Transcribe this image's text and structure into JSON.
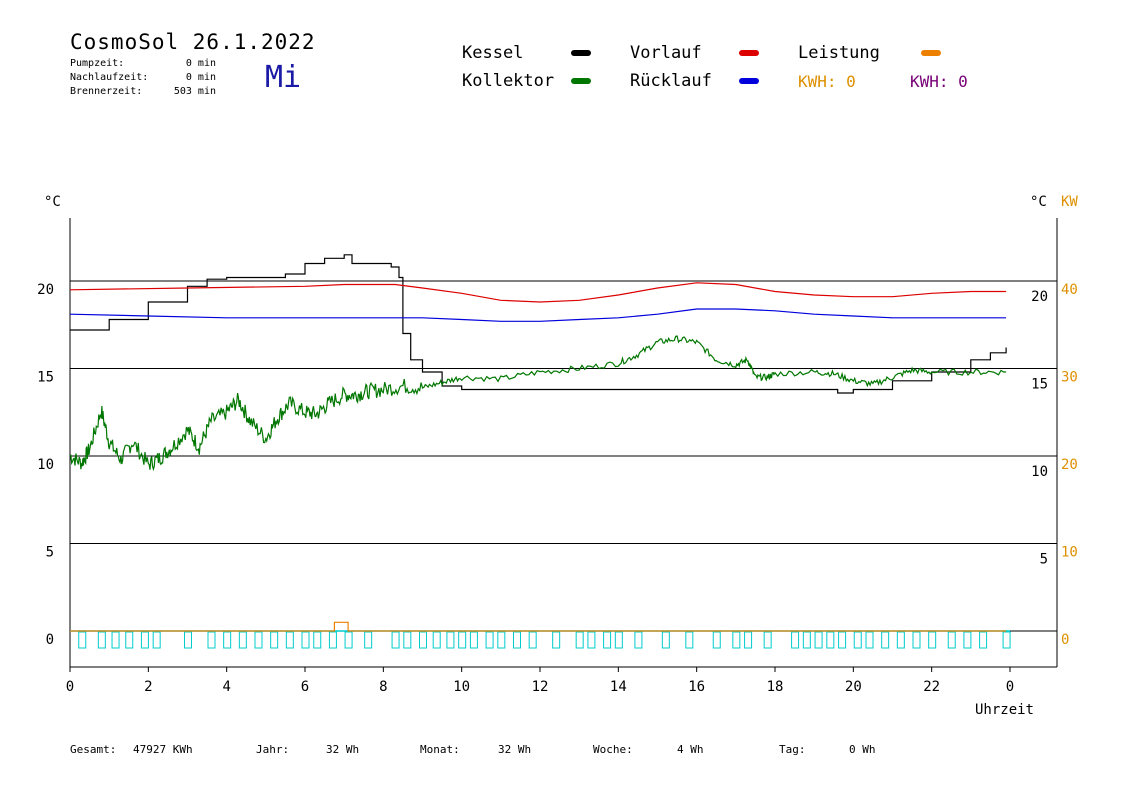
{
  "header": {
    "title": "CosmoSol 26.1.2022",
    "weekday": "Mi",
    "stats": [
      {
        "label": "Pumpzeit:",
        "value": "0 min"
      },
      {
        "label": "Nachlaufzeit:",
        "value": "0 min"
      },
      {
        "label": "Brennerzeit:",
        "value": "503 min"
      }
    ]
  },
  "legend": {
    "kessel": "Kessel",
    "kollektor": "Kollektor",
    "vorlauf": "Vorlauf",
    "ruecklauf": "Rücklauf",
    "leistung": "Leistung",
    "kwh_orange": "KWH: 0",
    "kwh_purple": "KWH: 0"
  },
  "colors": {
    "kessel": "#000000",
    "kollektor": "#007700",
    "vorlauf": "#dd0000",
    "ruecklauf": "#0000dd",
    "leistung": "#ee8000",
    "kw_axis": "#dd9000",
    "kwh_purple": "#770077",
    "pump": "#00cccc",
    "weekday": "#1a1aa6"
  },
  "footer": {
    "gesamt_label": "Gesamt:",
    "gesamt_value": "47927 KWh",
    "jahr_label": "Jahr:",
    "jahr_value": "32 Wh",
    "monat_label": "Monat:",
    "monat_value": "32 Wh",
    "woche_label": "Woche:",
    "woche_value": "4 Wh",
    "tag_label": "Tag:",
    "tag_value": "0 Wh"
  },
  "chart_data": {
    "type": "line",
    "x_label": "Uhrzeit",
    "x_ticks": [
      "0",
      "2",
      "4",
      "6",
      "8",
      "10",
      "12",
      "14",
      "16",
      "18",
      "20",
      "22",
      "0"
    ],
    "y_left_label": "°C",
    "y_left_ticks": [
      "0",
      "5",
      "10",
      "15",
      "20"
    ],
    "y_right_label": "°C",
    "y_right_ticks": [
      "5",
      "10",
      "15",
      "20"
    ],
    "y_kw_label": "KW",
    "y_kw_ticks": [
      "0",
      "10",
      "20",
      "30",
      "40"
    ],
    "xlim": [
      0,
      24
    ],
    "ylim": [
      -2,
      24
    ],
    "grid_lines_y": [
      0,
      5,
      10,
      15,
      20
    ],
    "series": [
      {
        "name": "Kessel",
        "color_key": "kessel",
        "step": true,
        "points": [
          [
            0,
            17.2
          ],
          [
            1,
            17.8
          ],
          [
            2,
            18.8
          ],
          [
            3,
            19.7
          ],
          [
            3.5,
            20.1
          ],
          [
            4,
            20.2
          ],
          [
            5,
            20.2
          ],
          [
            5.5,
            20.4
          ],
          [
            6,
            21
          ],
          [
            6.5,
            21.3
          ],
          [
            7,
            21.5
          ],
          [
            7.2,
            21
          ],
          [
            7.7,
            21
          ],
          [
            8.2,
            20.8
          ],
          [
            8.4,
            20.2
          ],
          [
            8.5,
            17
          ],
          [
            8.7,
            15.5
          ],
          [
            9,
            14.8
          ],
          [
            9.5,
            14
          ],
          [
            10,
            13.8
          ],
          [
            12,
            13.8
          ],
          [
            16,
            13.8
          ],
          [
            19.5,
            13.8
          ],
          [
            19.6,
            13.6
          ],
          [
            20,
            13.8
          ],
          [
            21,
            14.3
          ],
          [
            22,
            14.8
          ],
          [
            23,
            15.5
          ],
          [
            23.5,
            15.9
          ],
          [
            23.9,
            16.2
          ]
        ]
      },
      {
        "name": "Vorlauf",
        "color_key": "vorlauf",
        "points": [
          [
            0,
            19.5
          ],
          [
            3,
            19.6
          ],
          [
            6,
            19.7
          ],
          [
            7,
            19.8
          ],
          [
            8.3,
            19.8
          ],
          [
            9,
            19.6
          ],
          [
            10,
            19.3
          ],
          [
            11,
            18.9
          ],
          [
            12,
            18.8
          ],
          [
            13,
            18.9
          ],
          [
            14,
            19.2
          ],
          [
            15,
            19.6
          ],
          [
            16,
            19.9
          ],
          [
            17,
            19.8
          ],
          [
            18,
            19.4
          ],
          [
            19,
            19.2
          ],
          [
            20,
            19.1
          ],
          [
            21,
            19.1
          ],
          [
            22,
            19.3
          ],
          [
            23,
            19.4
          ],
          [
            23.9,
            19.4
          ]
        ]
      },
      {
        "name": "Rücklauf",
        "color_key": "ruecklauf",
        "points": [
          [
            0,
            18.1
          ],
          [
            2,
            18
          ],
          [
            4,
            17.9
          ],
          [
            6,
            17.9
          ],
          [
            8,
            17.9
          ],
          [
            9,
            17.9
          ],
          [
            10,
            17.8
          ],
          [
            11,
            17.7
          ],
          [
            12,
            17.7
          ],
          [
            13,
            17.8
          ],
          [
            14,
            17.9
          ],
          [
            15,
            18.1
          ],
          [
            16,
            18.4
          ],
          [
            17,
            18.4
          ],
          [
            18,
            18.3
          ],
          [
            19,
            18.1
          ],
          [
            20,
            18
          ],
          [
            21,
            17.9
          ],
          [
            22,
            17.9
          ],
          [
            23,
            17.9
          ],
          [
            23.9,
            17.9
          ]
        ]
      },
      {
        "name": "Kollektor",
        "color_key": "kollektor",
        "noisy": true,
        "points": [
          [
            0,
            10
          ],
          [
            0.3,
            9.6
          ],
          [
            0.5,
            10.4
          ],
          [
            0.8,
            12.6
          ],
          [
            1,
            10.8
          ],
          [
            1.3,
            9.8
          ],
          [
            1.6,
            10.8
          ],
          [
            2,
            9.5
          ],
          [
            2.3,
            9.9
          ],
          [
            2.6,
            10.5
          ],
          [
            3,
            11.5
          ],
          [
            3.3,
            10.5
          ],
          [
            3.6,
            12
          ],
          [
            4,
            12.5
          ],
          [
            4.3,
            13.2
          ],
          [
            4.6,
            12
          ],
          [
            5,
            11
          ],
          [
            5.3,
            12.2
          ],
          [
            5.6,
            13
          ],
          [
            6,
            12.5
          ],
          [
            6.3,
            12.4
          ],
          [
            6.6,
            13
          ],
          [
            7,
            13.5
          ],
          [
            7.3,
            13.5
          ],
          [
            7.6,
            13.7
          ],
          [
            8,
            13.8
          ],
          [
            8.5,
            14
          ],
          [
            9,
            13.9
          ],
          [
            9.5,
            14.2
          ],
          [
            10,
            14.5
          ],
          [
            11,
            14.4
          ],
          [
            12,
            14.8
          ],
          [
            13,
            15
          ],
          [
            14,
            15.3
          ],
          [
            14.5,
            15.8
          ],
          [
            15,
            16.5
          ],
          [
            15.5,
            16.7
          ],
          [
            16,
            16.5
          ],
          [
            16.5,
            15.5
          ],
          [
            17,
            15.2
          ],
          [
            17.3,
            15.5
          ],
          [
            17.5,
            14.5
          ],
          [
            17.8,
            14.5
          ],
          [
            18,
            14.7
          ],
          [
            19,
            14.8
          ],
          [
            19.5,
            14.7
          ],
          [
            20,
            14.3
          ],
          [
            20.5,
            14.1
          ],
          [
            21,
            14.5
          ],
          [
            21.5,
            14.9
          ],
          [
            22,
            14.8
          ],
          [
            23,
            14.8
          ],
          [
            23.9,
            14.8
          ]
        ]
      },
      {
        "name": "Leistung",
        "color_key": "leistung",
        "step": true,
        "points": [
          [
            0,
            0
          ],
          [
            6.75,
            0
          ],
          [
            6.75,
            0.5
          ],
          [
            7.1,
            0.5
          ],
          [
            7.1,
            0
          ],
          [
            23.9,
            0
          ]
        ]
      }
    ],
    "pump_pulses_hours": [
      0.3,
      0.8,
      1.15,
      1.5,
      1.9,
      2.2,
      3.0,
      3.6,
      4.0,
      4.4,
      4.8,
      5.2,
      5.6,
      6.0,
      6.3,
      6.7,
      7.1,
      7.6,
      8.3,
      8.6,
      9.0,
      9.35,
      9.7,
      10.0,
      10.3,
      10.7,
      11.0,
      11.4,
      11.8,
      12.4,
      13.0,
      13.3,
      13.7,
      14.0,
      14.5,
      15.2,
      15.8,
      16.5,
      17.0,
      17.3,
      17.8,
      18.5,
      18.8,
      19.1,
      19.4,
      19.7,
      20.1,
      20.4,
      20.8,
      21.2,
      21.6,
      22.0,
      22.5,
      22.9,
      23.3,
      23.9
    ]
  }
}
